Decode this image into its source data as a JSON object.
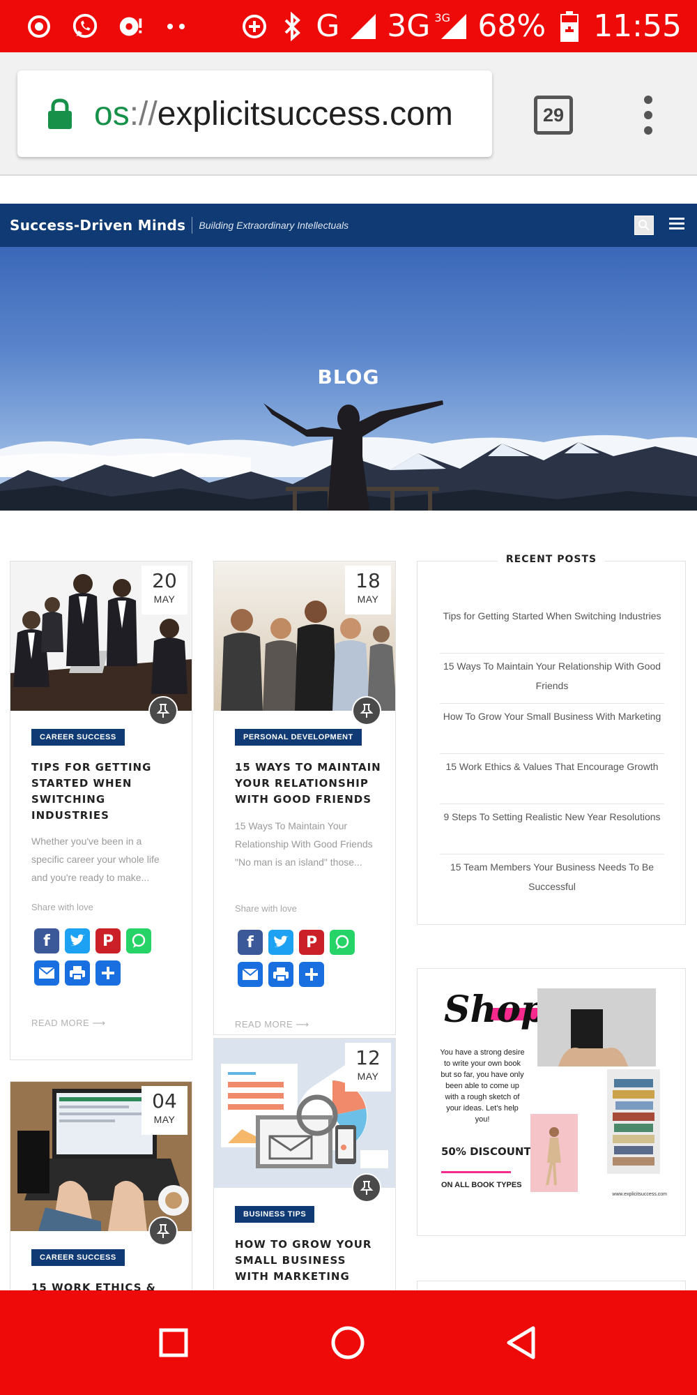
{
  "status_bar": {
    "network": "G",
    "network2": "3G",
    "network2_sup": "3G",
    "battery": "68%",
    "time": "11:55"
  },
  "browser": {
    "url_scheme_fragment": "os",
    "url_separator": "://",
    "url_host": "explicitsuccess.com",
    "tab_count": "29"
  },
  "site": {
    "title": "Success-Driven Minds",
    "tagline": "Building Extraordinary Intellectuals"
  },
  "hero": {
    "title": "BLOG"
  },
  "posts": [
    {
      "day": "20",
      "month": "MAY",
      "category": "CAREER SUCCESS",
      "title": "TIPS FOR GETTING STARTED WHEN SWITCHING INDUSTRIES",
      "excerpt": "Whether you've been in a specific career your whole life and you're ready to make...",
      "share_label": "Share with love",
      "read_more": "READ MORE"
    },
    {
      "day": "18",
      "month": "MAY",
      "category": "PERSONAL DEVELOPMENT",
      "title": "15 WAYS TO MAINTAIN YOUR RELATIONSHIP WITH GOOD FRIENDS",
      "excerpt": "15 Ways To Maintain Your Relationship With Good Friends \"No man is an island\" those...",
      "share_label": "Share with love",
      "read_more": "READ MORE"
    },
    {
      "day": "04",
      "month": "MAY",
      "category": "CAREER SUCCESS",
      "title": "15 WORK ETHICS &"
    },
    {
      "day": "12",
      "month": "MAY",
      "category": "BUSINESS TIPS",
      "title": "HOW TO GROW YOUR SMALL BUSINESS WITH MARKETING"
    }
  ],
  "sidebar": {
    "recent_title": "RECENT POSTS",
    "recent_posts": [
      "Tips for Getting Started When Switching Industries",
      "15 Ways To Maintain Your Relationship With Good Friends",
      "How To Grow Your Small Business With Marketing",
      "15 Work Ethics & Values That Encourage Growth",
      "9 Steps To Setting Realistic New Year Resolutions",
      "15 Team Members Your Business Needs To Be Successful"
    ],
    "shop": {
      "heading": "Shop",
      "body": "You have a strong desire to write your own book but so far, you have only been able to come up with a rough sketch of your ideas. Let's help you!",
      "discount": "50% DISCOUNT",
      "on_all": "ON ALL BOOK TYPES",
      "url": "www.explicitsuccess.com"
    }
  },
  "colors": {
    "status_bar": "#ef0a0a",
    "site_header": "#0f3a73",
    "accent_pink": "#f52a8c",
    "facebook": "#3b5998",
    "twitter": "#1da1f2",
    "pinterest": "#cb2027",
    "whatsapp": "#25d366",
    "email": "#1a6fe0"
  }
}
